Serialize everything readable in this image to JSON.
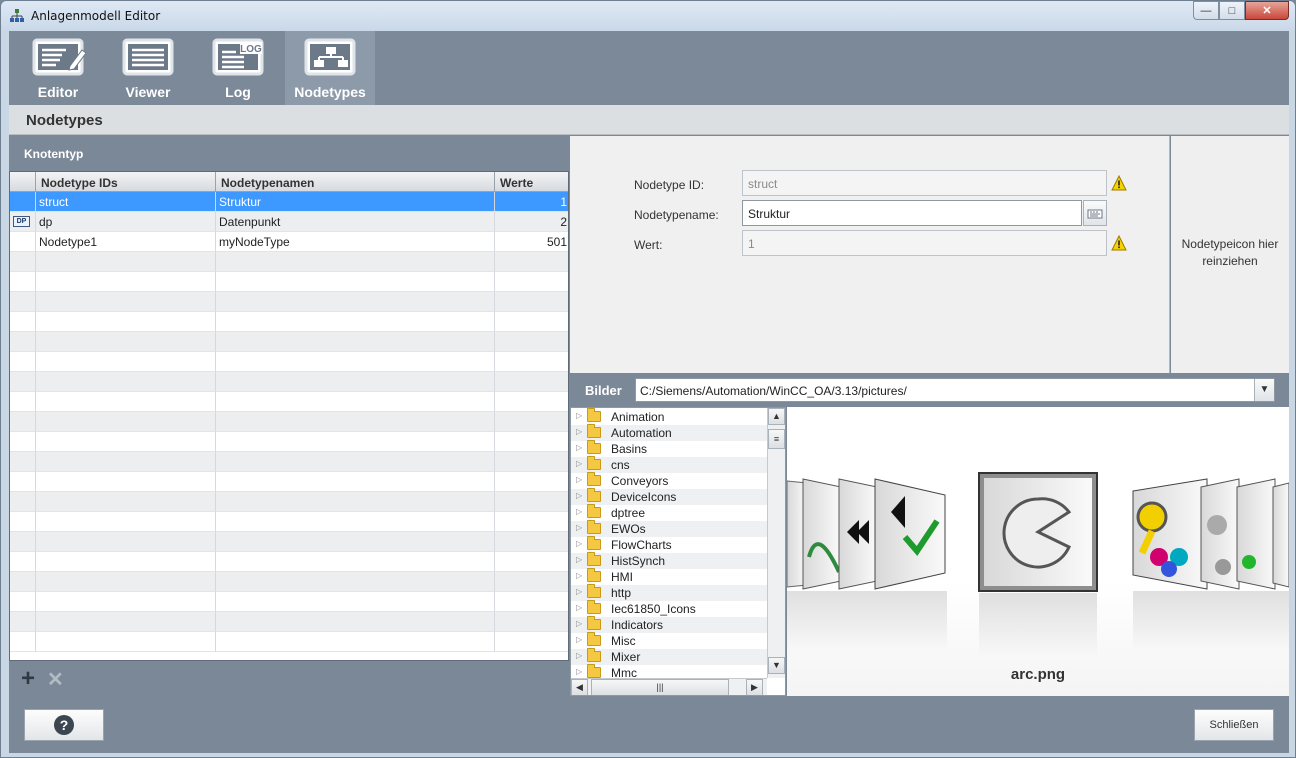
{
  "window": {
    "title": "Anlagenmodell Editor",
    "controls": {
      "minimize": "—",
      "maximize": "□",
      "close": "✕"
    }
  },
  "toolbar": {
    "items": [
      {
        "label": "Editor",
        "icon": "editor-icon",
        "active": false
      },
      {
        "label": "Viewer",
        "icon": "viewer-icon",
        "active": false
      },
      {
        "label": "Log",
        "icon": "log-icon",
        "icon_text": "LOG",
        "active": false
      },
      {
        "label": "Nodetypes",
        "icon": "nodetypes-icon",
        "active": true
      }
    ]
  },
  "page": {
    "title": "Nodetypes"
  },
  "knotentyp": {
    "heading": "Knotentyp",
    "columns": [
      "Nodetype IDs",
      "Nodetypenamen",
      "Werte"
    ],
    "rows": [
      {
        "id": "struct",
        "name": "Struktur",
        "value": "1",
        "selected": true,
        "icon": ""
      },
      {
        "id": "dp",
        "name": "Datenpunkt",
        "value": "2",
        "selected": false,
        "icon": "DP"
      },
      {
        "id": "Nodetype1",
        "name": "myNodeType",
        "value": "501",
        "selected": false,
        "icon": ""
      }
    ],
    "add_label": "+",
    "delete_label": "✕"
  },
  "form": {
    "id_label": "Nodetype ID:",
    "id_value": "struct",
    "name_label": "Nodetypename:",
    "name_value": "Struktur",
    "wert_label": "Wert:",
    "wert_value": "1"
  },
  "iconpanel": {
    "hint_line1": "Nodetypeicon hier",
    "hint_line2": "reinziehen"
  },
  "bilder": {
    "label": "Bilder",
    "path": "C:/Siemens/Automation/WinCC_OA/3.13/pictures/",
    "folders": [
      "Animation",
      "Automation",
      "Basins",
      "cns",
      "Conveyors",
      "DeviceIcons",
      "dptree",
      "EWOs",
      "FlowCharts",
      "HistSynch",
      "HMI",
      "http",
      "Iec61850_Icons",
      "Indicators",
      "Misc",
      "Mixer",
      "Mmc"
    ],
    "selected_image": "arc.png"
  },
  "footer": {
    "help_label": "?",
    "close_label": "Schließen"
  },
  "colors": {
    "selection": "#3d98ff",
    "panel": "#7b8898",
    "toolbar_active": "#8d9aaa"
  }
}
